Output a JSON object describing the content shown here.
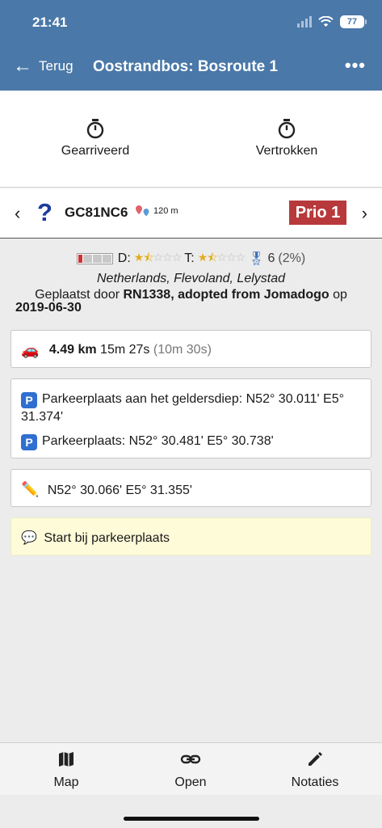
{
  "status": {
    "time": "21:41",
    "battery": "77"
  },
  "nav": {
    "back_label": "Terug",
    "title": "Oostrandbos: Bosroute 1",
    "more": "•••"
  },
  "timers": {
    "arrived": "Gearriveerd",
    "departed": "Vertrokken"
  },
  "cache": {
    "code": "GC81NC6",
    "distance": "120 m",
    "priority": "Prio 1",
    "difficulty_label": "D:",
    "terrain_label": "T:",
    "difficulty_stars": "1.5",
    "terrain_stars": "1.5",
    "favorites": "6",
    "favorites_pct": "(2%)",
    "location": "Netherlands, Flevoland, Lelystad",
    "placed_prefix": "Geplaatst door",
    "placed_by": "RN1338, adopted from Jomadogo",
    "placed_suffix": "op",
    "placed_date": "2019-06-30"
  },
  "route": {
    "distance": "4.49 km",
    "time": "15m 27s",
    "alt_time": "(10m 30s)"
  },
  "parking": [
    {
      "label": "Parkeerplaats aan het geldersdiep: N52° 30.011' E5° 31.374'"
    },
    {
      "label": "Parkeerplaats: N52° 30.481' E5° 30.738'"
    }
  ],
  "parking_icon": "P",
  "note": {
    "coords": "N52° 30.066' E5° 31.355'"
  },
  "hint": {
    "text": "Start bij parkeerplaats"
  },
  "toolbar": {
    "map": "Map",
    "open": "Open",
    "notes": "Notaties"
  },
  "colors": {
    "nav_bg": "#4a78a8",
    "prio_bg": "#b8393b",
    "hint_bg": "#fdfbd8",
    "parking_icon": "#2f6fd0"
  }
}
